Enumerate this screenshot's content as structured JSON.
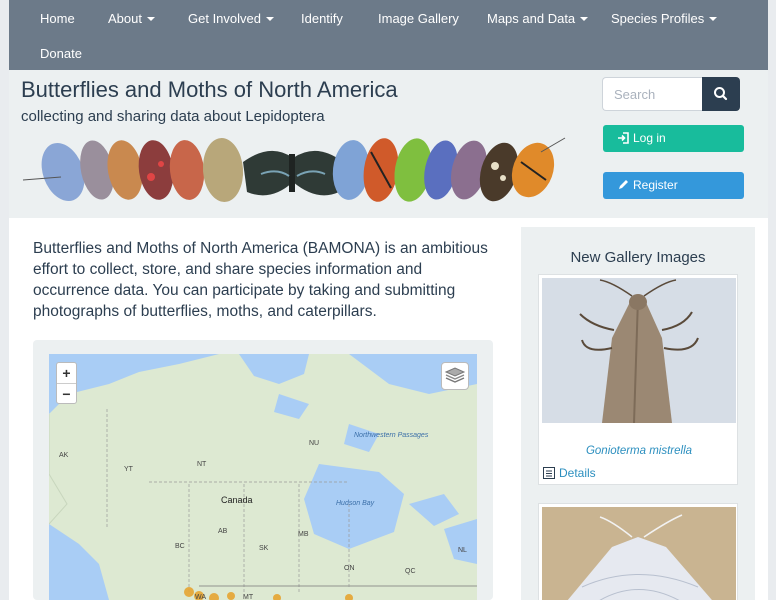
{
  "nav": {
    "home": "Home",
    "about": "About",
    "get_involved": "Get Involved",
    "identify": "Identify",
    "image_gallery": "Image Gallery",
    "maps_and_data": "Maps and Data",
    "species_profiles": "Species Profiles",
    "donate": "Donate"
  },
  "header": {
    "title": "Butterflies and Moths of North America",
    "subtitle": "collecting and sharing data about Lepidoptera",
    "search_placeholder": "Search",
    "login_label": "Log in",
    "register_label": "Register"
  },
  "main": {
    "intro": "Butterflies and Moths of North America (BAMONA) is an ambitious effort to collect, store, and share species information and occurrence data. You can participate by taking and submitting photographs of butterflies, moths, and caterpillars.",
    "map": {
      "zoom_in": "+",
      "zoom_out": "−",
      "labels": {
        "ak": "AK",
        "yt": "YT",
        "nt": "NT",
        "nu": "NU",
        "canada": "Canada",
        "hudson_bay": "Hudson Bay",
        "northwestern_passages": "Northwestern Passages",
        "ab": "AB",
        "bc": "BC",
        "sk": "SK",
        "mb": "MB",
        "on": "ON",
        "qc": "QC",
        "nl": "NL",
        "wa": "WA",
        "mt": "MT"
      }
    }
  },
  "sidebar": {
    "title": "New Gallery Images",
    "items": [
      {
        "caption": "Gonioterma mistrella",
        "details_label": "Details"
      }
    ]
  },
  "colors": {
    "navbar": "#6c7a89",
    "header_bg": "#ecf0f1",
    "title": "#2c3e50",
    "login": "#18bc9c",
    "register": "#3498db",
    "link": "#2c8fbf"
  }
}
